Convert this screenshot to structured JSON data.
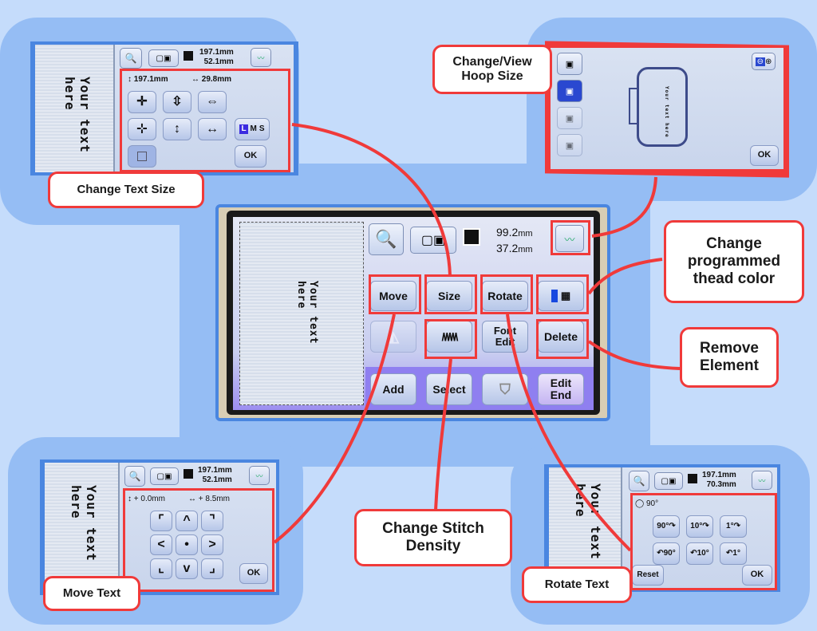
{
  "callouts": {
    "change_text_size": "Change Text Size",
    "change_view_hoop_size": "Change/View Hoop Size",
    "change_thread_color": "Change programmed thead color",
    "remove_element": "Remove Element",
    "change_stitch_density": "Change Stitch Density",
    "move_text": "Move Text",
    "rotate_text": "Rotate Text"
  },
  "main_screen": {
    "preview_text_line1": "Your text",
    "preview_text_line2": "here",
    "width_value": "99.2",
    "height_value": "37.2",
    "unit": "mm",
    "buttons": {
      "move": "Move",
      "size": "Size",
      "rotate": "Rotate",
      "font_edit_line1": "Font",
      "font_edit_line2": "Edit",
      "delete": "Delete",
      "add": "Add",
      "select": "Select",
      "edit_end_line1": "Edit",
      "edit_end_line2": "End"
    }
  },
  "size_screen": {
    "preview_text_line1": "Your text",
    "preview_text_line2": "here",
    "dim_top": "197.1mm",
    "dim_bottom": "52.1mm",
    "height_readout": "197.1mm",
    "width_readout": "29.8mm",
    "lms": [
      "L",
      "M",
      "S"
    ],
    "ok": "OK"
  },
  "hoop_screen": {
    "preview_text": "Your text here",
    "ok": "OK"
  },
  "move_screen": {
    "preview_text_line1": "Your text",
    "preview_text_line2": "here",
    "dim_top": "197.1mm",
    "dim_bottom": "52.1mm",
    "vertical_offset": "0.0mm",
    "horizontal_offset": "8.5mm",
    "arrows": [
      "⌜",
      "^",
      "⌝",
      "<",
      "•",
      ">",
      "⌞",
      "v",
      "⌟"
    ],
    "ok": "OK"
  },
  "rotate_screen": {
    "preview_text_line1": "Your text",
    "preview_text_line2": "here",
    "dim_top": "197.1mm",
    "dim_bottom": "70.3mm",
    "angle": "90°",
    "buttons": [
      "90°↷",
      "10°↷",
      "1°↷",
      "↶90°",
      "↶10°",
      "↶1°"
    ],
    "reset": "Reset",
    "ok": "OK"
  },
  "colors": {
    "background": "#c5dcfb",
    "panel": "#95bdf4",
    "highlight": "#f03a3a"
  }
}
